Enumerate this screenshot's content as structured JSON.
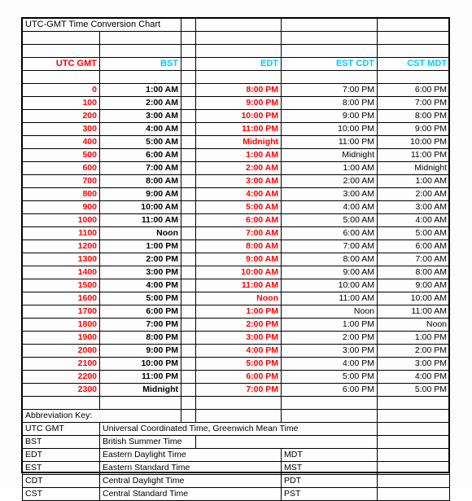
{
  "document": {
    "title": "UTC-GMT Time Conversion Chart"
  },
  "colors": {
    "utc_column": "#ff0000",
    "edt_column": "#ff0000",
    "header_accent": "#00ccff",
    "text": "#000000",
    "grid": "#000000",
    "background": "#ffffff"
  },
  "table": {
    "headers": {
      "utc": "UTC GMT",
      "bst": "BST",
      "spacer": "",
      "edt": "EDT",
      "est_cdt": "EST CDT",
      "cst_mdt": "CST MDT"
    },
    "rows": [
      {
        "utc": "0",
        "bst": "1:00 AM",
        "edt": "8:00 PM",
        "est_cdt": "7:00 PM",
        "cst_mdt": "6:00 PM"
      },
      {
        "utc": "100",
        "bst": "2:00 AM",
        "edt": "9:00 PM",
        "est_cdt": "8:00 PM",
        "cst_mdt": "7:00 PM"
      },
      {
        "utc": "200",
        "bst": "3:00 AM",
        "edt": "10:00 PM",
        "est_cdt": "9:00 PM",
        "cst_mdt": "8:00 PM"
      },
      {
        "utc": "300",
        "bst": "4:00 AM",
        "edt": "11:00 PM",
        "est_cdt": "10:00 PM",
        "cst_mdt": "9:00 PM"
      },
      {
        "utc": "400",
        "bst": "5:00 AM",
        "edt": "Midnight",
        "est_cdt": "11:00 PM",
        "cst_mdt": "10:00 PM"
      },
      {
        "utc": "500",
        "bst": "6:00 AM",
        "edt": "1:00 AM",
        "est_cdt": "Midnight",
        "cst_mdt": "11:00 PM"
      },
      {
        "utc": "600",
        "bst": "7:00 AM",
        "edt": "2:00 AM",
        "est_cdt": "1:00 AM",
        "cst_mdt": "Midnight"
      },
      {
        "utc": "700",
        "bst": "8:00 AM",
        "edt": "3:00 AM",
        "est_cdt": "2:00 AM",
        "cst_mdt": "1:00 AM"
      },
      {
        "utc": "800",
        "bst": "9:00 AM",
        "edt": "4:00 AM",
        "est_cdt": "3:00 AM",
        "cst_mdt": "2:00 AM"
      },
      {
        "utc": "900",
        "bst": "10:00 AM",
        "edt": "5:00 AM",
        "est_cdt": "4:00 AM",
        "cst_mdt": "3:00 AM"
      },
      {
        "utc": "1000",
        "bst": "11:00 AM",
        "edt": "6:00 AM",
        "est_cdt": "5:00 AM",
        "cst_mdt": "4:00 AM"
      },
      {
        "utc": "1100",
        "bst": "Noon",
        "edt": "7:00 AM",
        "est_cdt": "6:00 AM",
        "cst_mdt": "5:00 AM"
      },
      {
        "utc": "1200",
        "bst": "1:00 PM",
        "edt": "8:00 AM",
        "est_cdt": "7:00 AM",
        "cst_mdt": "6:00 AM"
      },
      {
        "utc": "1300",
        "bst": "2:00 PM",
        "edt": "9:00 AM",
        "est_cdt": "8:00 AM",
        "cst_mdt": "7:00 AM"
      },
      {
        "utc": "1400",
        "bst": "3:00 PM",
        "edt": "10:00 AM",
        "est_cdt": "9:00 AM",
        "cst_mdt": "8:00 AM"
      },
      {
        "utc": "1500",
        "bst": "4:00 PM",
        "edt": "11:00 AM",
        "est_cdt": "10:00 AM",
        "cst_mdt": "9:00 AM"
      },
      {
        "utc": "1600",
        "bst": "5:00 PM",
        "edt": "Noon",
        "est_cdt": "11:00 AM",
        "cst_mdt": "10:00 AM"
      },
      {
        "utc": "1700",
        "bst": "6:00 PM",
        "edt": "1:00 PM",
        "est_cdt": "Noon",
        "cst_mdt": "11:00 AM"
      },
      {
        "utc": "1800",
        "bst": "7:00 PM",
        "edt": "2:00 PM",
        "est_cdt": "1:00 PM",
        "cst_mdt": "Noon"
      },
      {
        "utc": "1900",
        "bst": "8:00 PM",
        "edt": "3:00 PM",
        "est_cdt": "2:00 PM",
        "cst_mdt": "1:00 PM"
      },
      {
        "utc": "2000",
        "bst": "9:00 PM",
        "edt": "4:00 PM",
        "est_cdt": "3:00 PM",
        "cst_mdt": "2:00 PM"
      },
      {
        "utc": "2100",
        "bst": "10:00 PM",
        "edt": "5:00 PM",
        "est_cdt": "4:00 PM",
        "cst_mdt": "3:00 PM"
      },
      {
        "utc": "2200",
        "bst": "11:00 PM",
        "edt": "6:00 PM",
        "est_cdt": "5:00 PM",
        "cst_mdt": "4:00 PM"
      },
      {
        "utc": "2300",
        "bst": "Midnight",
        "edt": "7:00 PM",
        "est_cdt": "6:00 PM",
        "cst_mdt": "5:00 PM"
      }
    ]
  },
  "abbreviation_key": {
    "heading": "Abbreviation Key:",
    "entries": [
      {
        "abbr": "UTC GMT",
        "meaning": "Universal Coordinated Time, Greenwich Mean Time",
        "alt": ""
      },
      {
        "abbr": "BST",
        "meaning": "British Summer Time",
        "alt": ""
      },
      {
        "abbr": "EDT",
        "meaning": "Eastern Daylight Time",
        "alt": "MDT"
      },
      {
        "abbr": "EST",
        "meaning": "Eastern Standard Time",
        "alt": "MST"
      },
      {
        "abbr": "CDT",
        "meaning": "Central Daylight Time",
        "alt": "PDT"
      },
      {
        "abbr": "CST",
        "meaning": "Central Standard Time",
        "alt": "PST"
      }
    ]
  }
}
